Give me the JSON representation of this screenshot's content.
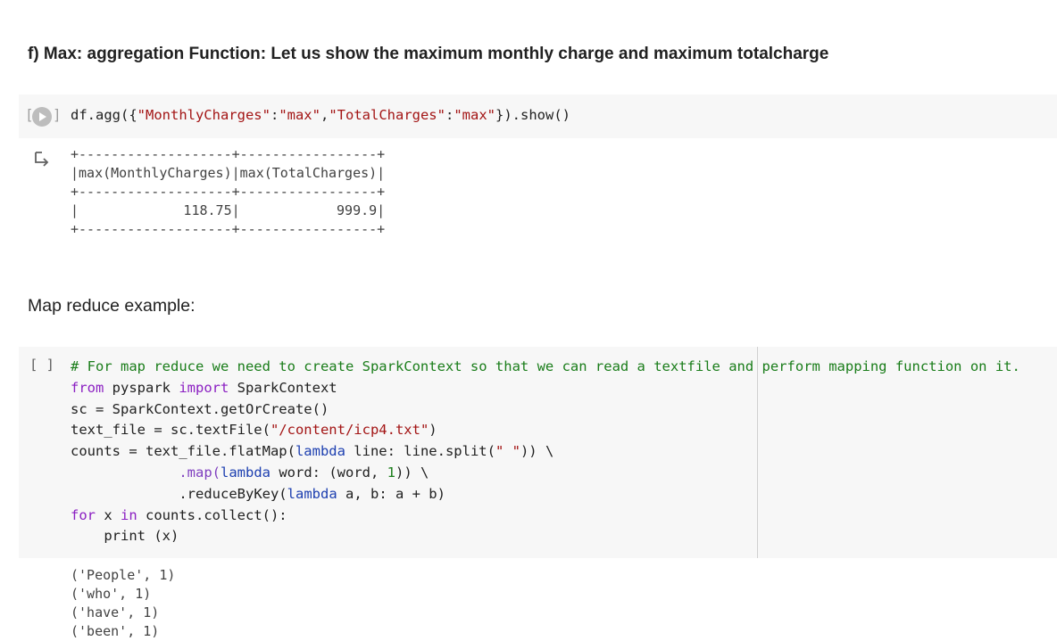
{
  "heading": "f) Max: aggregation Function: Let us show the maximum monthly charge and maximum totalcharge",
  "cell1": {
    "brackets": [
      "[",
      "]"
    ],
    "code_plain": "df.agg({",
    "string1": "\"MonthlyCharges\"",
    "colon1": ":",
    "string2": "\"max\"",
    "comma": ",",
    "string3": "\"TotalCharges\"",
    "colon2": ":",
    "string4": "\"max\"",
    "code_end": "}).show()"
  },
  "output1": {
    "border": "+-------------------+-----------------+",
    "header": "|max(MonthlyCharges)|max(TotalCharges)|",
    "row": "|             118.75|            999.9|"
  },
  "subheading": "Map reduce example:",
  "cell2": {
    "prompt": "[ ]",
    "comment": "# For map reduce we need to create SparkContext so that we can read a textfile and perform mapping function on it.",
    "line2": {
      "kw1": "from",
      "mod": " pyspark ",
      "kw2": "import",
      "rest": " SparkContext"
    },
    "line3": "sc = SparkContext.getOrCreate()",
    "line4": {
      "pre": "text_file = sc.textFile(",
      "str": "\"/content/icp4.txt\"",
      "post": ")"
    },
    "line5": {
      "pre": "counts = text_file.flatMap(",
      "kw": "lambda",
      "mid": " line: line.split(",
      "str": "\" \"",
      "post": ")) \\"
    },
    "line6": {
      "indent": "             ",
      "meth": ".map(",
      "kw": "lambda",
      "mid": " word: (word, ",
      "num": "1",
      "post": ")) \\"
    },
    "line7": {
      "indent": "             ",
      "pre": ".reduceByKey(",
      "kw": "lambda",
      "post": " a, b: a + b)"
    },
    "line8": {
      "kw1": "for",
      "mid1": " x ",
      "kw2": "in",
      "post": " counts.collect():"
    },
    "line9": "    print (x)"
  },
  "output2": [
    "('People', 1)",
    "('who', 1)",
    "('have', 1)",
    "('been', 1)"
  ]
}
